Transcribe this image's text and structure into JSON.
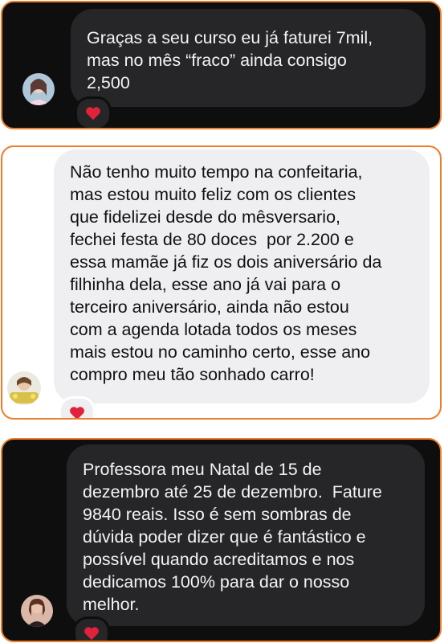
{
  "messages": [
    {
      "theme": "dark",
      "lines": [
        "Graças a seu curso eu já faturei 7mil,",
        "mas no mês “fraco” ainda consigo",
        "2,500"
      ],
      "reaction": "red-heart-emoji",
      "avatar": "user-avatar-1"
    },
    {
      "theme": "light",
      "lines": [
        "Não tenho muito tempo na confeitaria,",
        "mas estou muito feliz com os clientes",
        "que fidelizei desde do mêsversario,",
        "fechei festa de 80 doces  por 2.200 e",
        "essa mamãe já fiz os dois aniversário da",
        "filhinha dela, esse ano já vai para o",
        "terceiro aniversário, ainda não estou",
        "com a agenda lotada todos os meses",
        "mais estou no caminho certo, esse ano",
        "compro meu tão sonhado carro!"
      ],
      "reaction": "red-heart-emoji",
      "avatar": "user-avatar-2"
    },
    {
      "theme": "dark",
      "lines": [
        "Professora meu Natal de 15 de",
        "dezembro até 25 de dezembro.  Fature",
        "9840 reais. Isso é sem sombras de",
        "dúvida poder dizer que é fantástico e",
        "possível quando acreditamos e nos",
        "dedicamos 100% para dar o nosso",
        "melhor."
      ],
      "reaction": "red-heart-emoji",
      "avatar": "user-avatar-3"
    }
  ],
  "colors": {
    "card_border": "#ee7d2b",
    "dark_background": "#0e0e0e",
    "dark_bubble": "#262628",
    "light_bubble": "#efeff1",
    "heart": "#e0233a"
  }
}
